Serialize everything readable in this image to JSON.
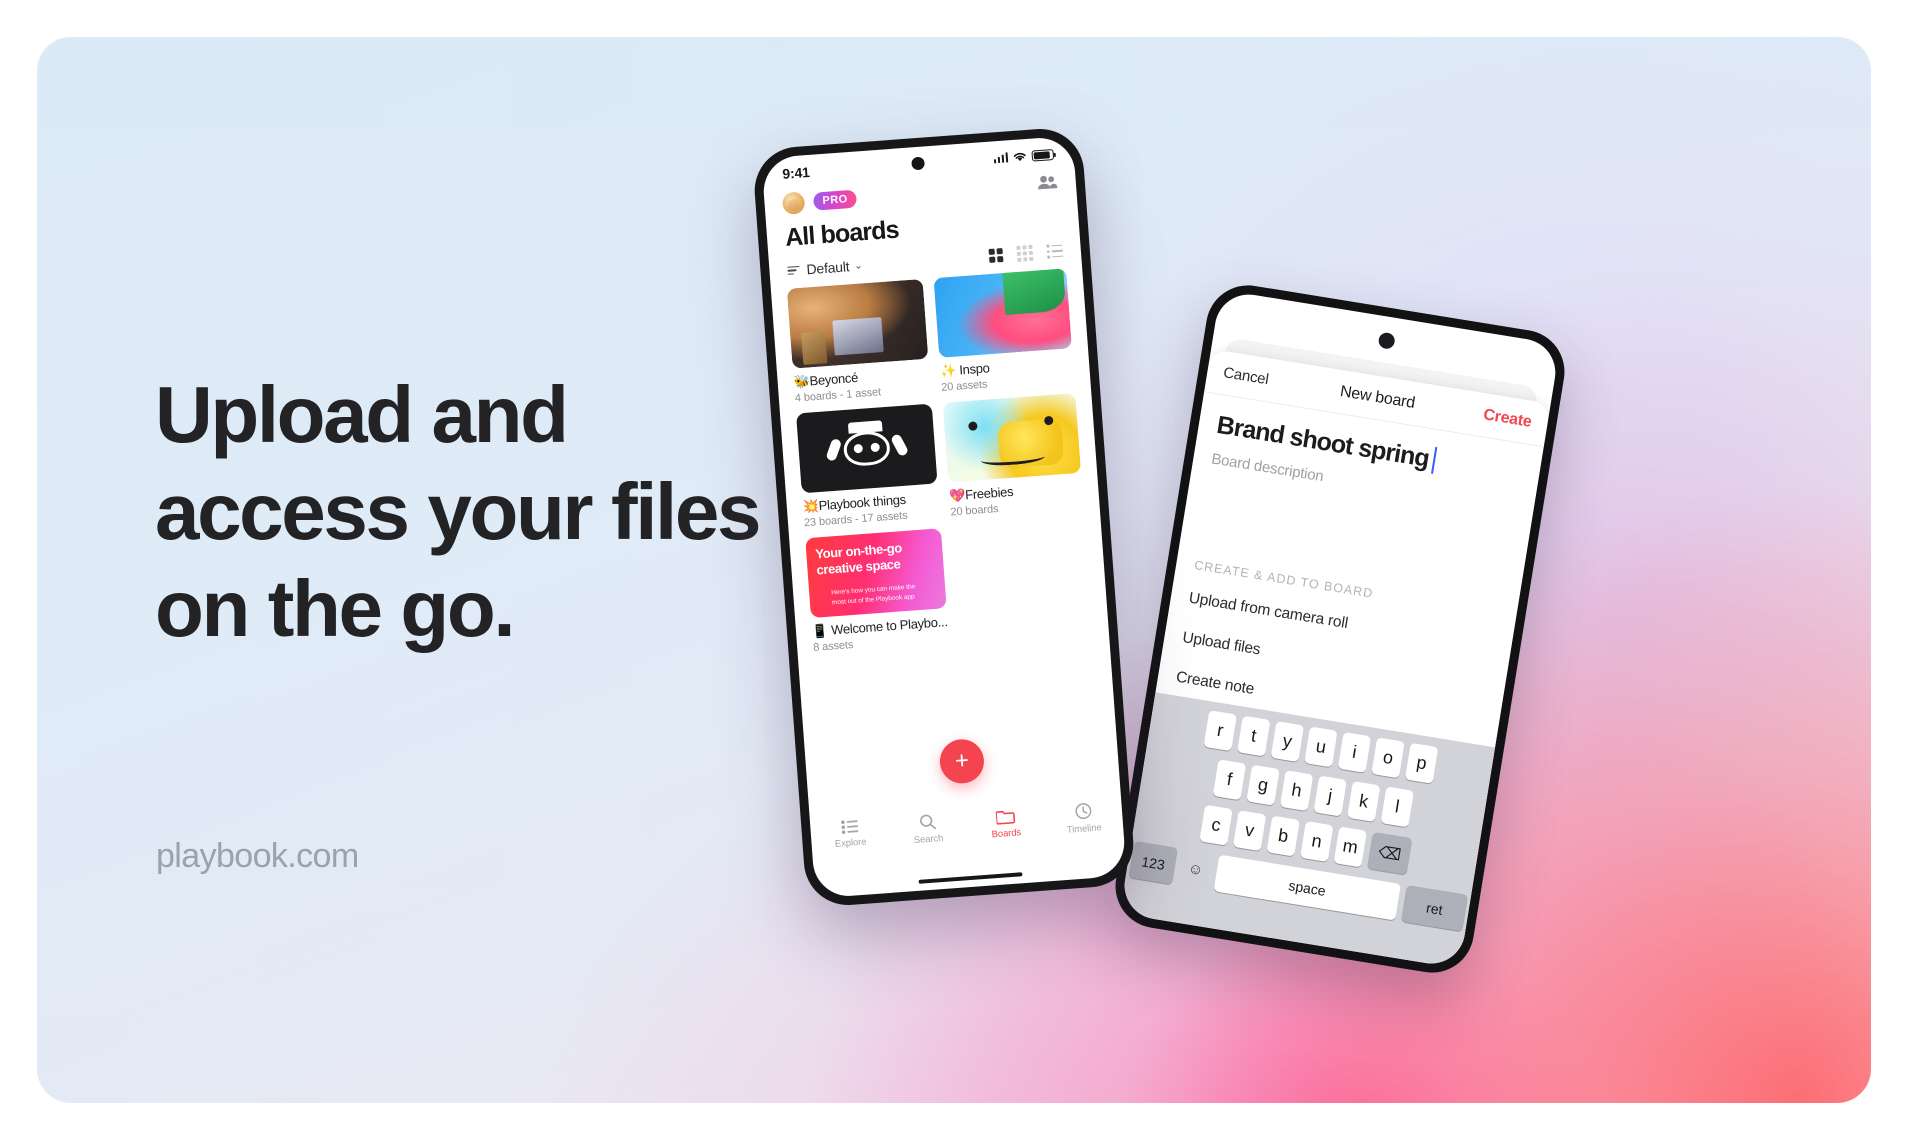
{
  "hero": {
    "headline": "Upload and access your files on the go.",
    "site_url": "playbook.com",
    "accent_red": "#f4444f",
    "text_dark": "#232326",
    "bg_top_left": "#dcebf7",
    "bg_bottom_right": "#ff5a5f"
  },
  "phone_boards": {
    "status": {
      "time": "9:41",
      "signal_icon": "cellular-bars-icon",
      "wifi_icon": "wifi-icon",
      "battery_icon": "battery-icon"
    },
    "account": {
      "avatar_icon": "avatar",
      "plan_badge": "PRO",
      "members_icon": "people-icon"
    },
    "title": "All boards",
    "sort": {
      "label": "Default",
      "chevron": "⌄",
      "filter_icon": "sort-icon"
    },
    "views": [
      {
        "name": "grid-large-view",
        "active": true
      },
      {
        "name": "grid-small-view",
        "active": false
      },
      {
        "name": "list-view",
        "active": false
      }
    ],
    "boards": [
      {
        "emoji": "🐝",
        "title": "Beyoncé",
        "meta": "4 boards - 1 asset",
        "thumb": "th-beyonce"
      },
      {
        "emoji": "✨",
        "title": "Inspo",
        "meta": "20 assets",
        "thumb": "th-inspo"
      },
      {
        "emoji": "💥",
        "title": "Playbook things",
        "meta": "23 boards - 17 assets",
        "thumb": "th-playbook"
      },
      {
        "emoji": "💖",
        "title": "Freebies",
        "meta": "20 boards",
        "thumb": "th-freebies"
      },
      {
        "emoji": "📱",
        "title": "Welcome to Playbo...",
        "meta": "8 assets",
        "thumb": "th-welcome"
      }
    ],
    "promo_card": {
      "heading": "Your on-the-go creative space",
      "subheading": "Here's how you can make the most out of the Playbook app"
    },
    "fab_label": "+",
    "tabs": [
      {
        "label": "Explore",
        "icon": "list-icon",
        "active": false
      },
      {
        "label": "Search",
        "icon": "search-icon",
        "active": false
      },
      {
        "label": "Boards",
        "icon": "folder-icon",
        "active": true
      },
      {
        "label": "Timeline",
        "icon": "clock-icon",
        "active": false
      }
    ]
  },
  "phone_new_board": {
    "nav": {
      "cancel": "Cancel",
      "title": "New board",
      "create": "Create"
    },
    "form": {
      "board_name_value": "Brand shoot spring",
      "description_placeholder": "Board description",
      "section_label": "CREATE & ADD TO BOARD",
      "actions": [
        "Upload from camera roll",
        "Upload files",
        "Create note"
      ]
    },
    "keyboard": {
      "row1": [
        "r",
        "t",
        "y",
        "u",
        "i",
        "o",
        "p"
      ],
      "row2": [
        "f",
        "g",
        "h",
        "j",
        "k",
        "l"
      ],
      "row3": [
        "c",
        "v",
        "b",
        "n",
        "m"
      ],
      "backspace": "⌫",
      "numbers_key": "123",
      "space_key": "space",
      "return_key": "ret",
      "emoji_key": "☺"
    }
  }
}
